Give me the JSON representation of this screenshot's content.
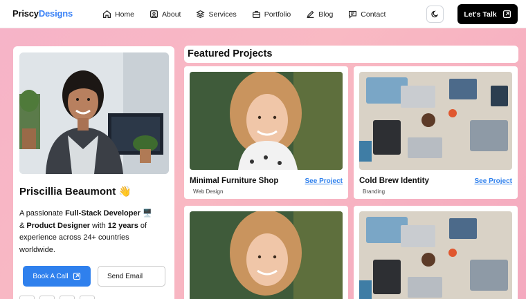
{
  "header": {
    "brand_part1": "Priscy",
    "brand_part2": "Designs",
    "nav": [
      "Home",
      "About",
      "Services",
      "Portfolio",
      "Blog",
      "Contact"
    ],
    "cta_label": "Let's Talk"
  },
  "profile": {
    "name": "Priscillia Beaumont 👋",
    "bio_intro": "A passionate ",
    "bio_role1": "Full-Stack Developer",
    "bio_emoji1": " 🖥️ & ",
    "bio_role2": "Product Designer",
    "bio_with": " with ",
    "bio_years": "12 years",
    "bio_rest": " of experience across 24+ countries worldwide.",
    "book_label": "Book A Call",
    "email_label": "Send Email"
  },
  "featured": {
    "title": "Featured Projects",
    "projects": [
      {
        "title": "Minimal Furniture Shop",
        "category": "Web Design",
        "link": "See Project"
      },
      {
        "title": "Cold Brew Identity",
        "category": "Branding",
        "link": "See Project"
      },
      {
        "title": "",
        "category": "",
        "link": ""
      },
      {
        "title": "",
        "category": "",
        "link": ""
      }
    ]
  },
  "colors": {
    "accent": "#2f80ed",
    "brand_blue": "#3b82f6",
    "background_pink": "#f9b9c3"
  },
  "icons": [
    "home-icon",
    "about-icon",
    "services-icon",
    "portfolio-icon",
    "blog-icon",
    "contact-icon",
    "moon-icon",
    "external-link-icon"
  ]
}
